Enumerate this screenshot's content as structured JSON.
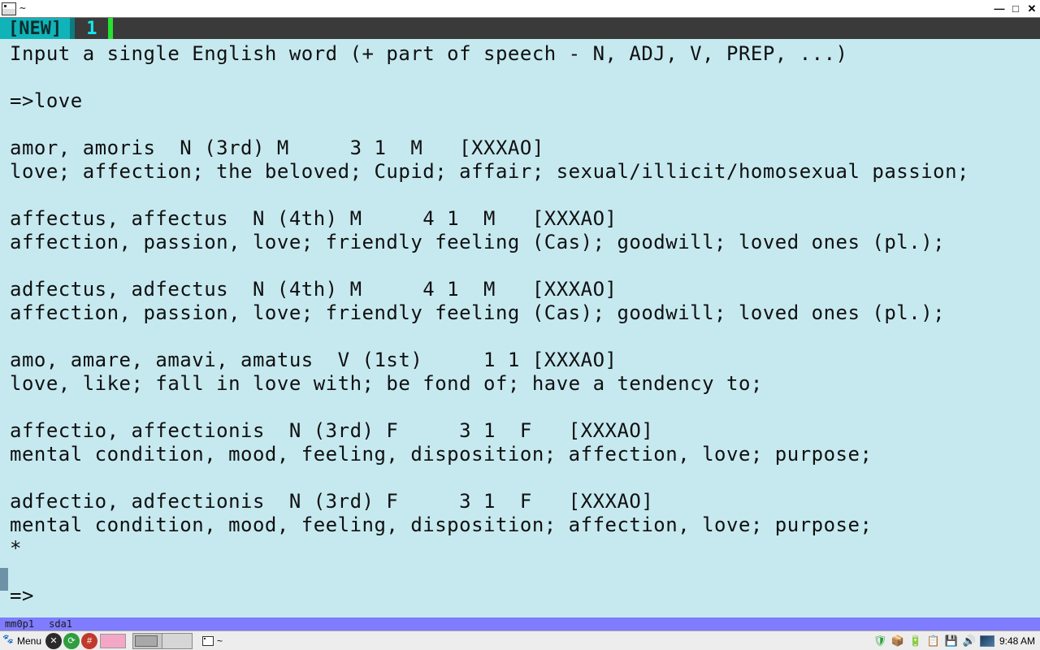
{
  "titlebar": {
    "title": "~",
    "min": "—",
    "max": "□",
    "close": "✕"
  },
  "statusbar": {
    "mode": "[NEW]",
    "num": "1"
  },
  "terminal": {
    "intro": "Input a single English word (+ part of speech - N, ADJ, V, PREP, ...)",
    "prompt1": "=>love",
    "entries": [
      {
        "head": "amor, amoris  N (3rd) M     3 1  M   [XXXAO]",
        "def": "love; affection; the beloved; Cupid; affair; sexual/illicit/homosexual passion;"
      },
      {
        "head": "affectus, affectus  N (4th) M     4 1  M   [XXXAO]",
        "def": "affection, passion, love; friendly feeling (Cas); goodwill; loved ones (pl.);"
      },
      {
        "head": "adfectus, adfectus  N (4th) M     4 1  M   [XXXAO]",
        "def": "affection, passion, love; friendly feeling (Cas); goodwill; loved ones (pl.);"
      },
      {
        "head": "amo, amare, amavi, amatus  V (1st)     1 1 [XXXAO]",
        "def": "love, like; fall in love with; be fond of; have a tendency to;"
      },
      {
        "head": "affectio, affectionis  N (3rd) F     3 1  F   [XXXAO]",
        "def": "mental condition, mood, feeling, disposition; affection, love; purpose;"
      },
      {
        "head": "adfectio, adfectionis  N (3rd) F     3 1  F   [XXXAO]",
        "def": "mental condition, mood, feeling, disposition; affection, love; purpose;"
      }
    ],
    "star": "*",
    "prompt2": "=>"
  },
  "devbar": {
    "d1": "mm0p1",
    "d2": "sda1"
  },
  "taskbar": {
    "menu": "Menu",
    "task_title": "~",
    "clock": "9:48 AM"
  }
}
